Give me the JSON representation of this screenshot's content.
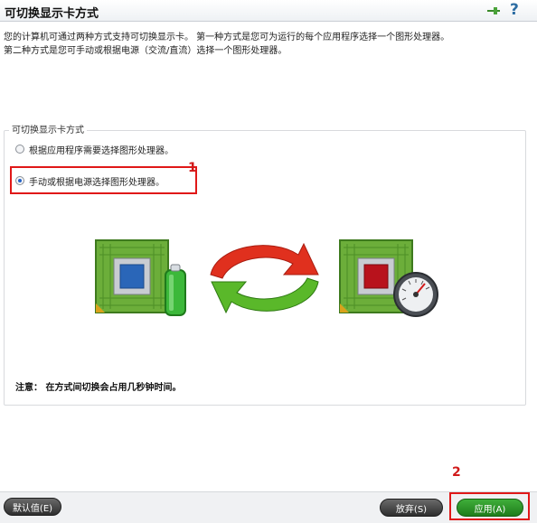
{
  "window": {
    "title": "可切换显示卡方式"
  },
  "intro": {
    "line1": "您的计算机可通过两种方式支持可切换显示卡。 第一种方式是您可为运行的每个应用程序选择一个图形处理器。",
    "line2": "第二种方式是您可手动或根据电源（交流/直流）选择一个图形处理器。"
  },
  "mode_group": {
    "title": "可切换显示卡方式",
    "options": [
      {
        "label": "根据应用程序需要选择图形处理器。",
        "selected": false
      },
      {
        "label": "手动或根据电源选择图形处理器。",
        "selected": true
      }
    ]
  },
  "annotations": {
    "marker1": "1",
    "marker2": "2"
  },
  "note": "注意： 在方式间切换会占用几秒钟时间。",
  "footer": {
    "default_label": "默认值(E)",
    "cancel_label": "放弃(S)",
    "apply_label": "应用(A)"
  },
  "colors": {
    "highlight": "#e01818",
    "apply_button": "#2e9a2a",
    "chip_blue": "#2a66b8",
    "chip_red": "#b8121c",
    "board_green": "#6cae3a"
  },
  "icons": {
    "pin": "pin-icon",
    "help": "help-icon",
    "battery": "battery-icon",
    "gauge": "gauge-icon",
    "switch_arrows": "switch-arrows-icon"
  }
}
